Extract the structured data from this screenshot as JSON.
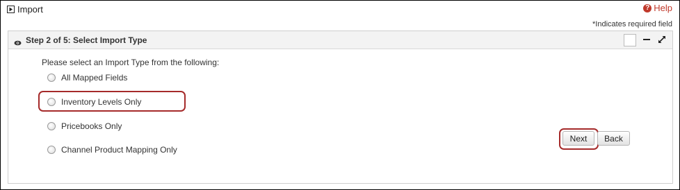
{
  "window": {
    "title": "Import",
    "help_label": "Help",
    "required_note": "*Indicates required field"
  },
  "panel": {
    "title": "Step 2 of 5: Select Import Type",
    "prompt": "Please select an Import Type from the following:",
    "options": [
      {
        "label": "All Mapped Fields",
        "selected": false
      },
      {
        "label": "Inventory Levels Only",
        "selected": false,
        "highlighted": true
      },
      {
        "label": "Pricebooks Only",
        "selected": false
      },
      {
        "label": "Channel Product Mapping Only",
        "selected": false
      }
    ]
  },
  "buttons": {
    "next_label": "Next",
    "back_label": "Back"
  },
  "colors": {
    "accent_red": "#a52a2a",
    "help_red": "#c0392b"
  },
  "icons": {
    "title_icon": "play-square-icon",
    "help_icon": "question-circle-icon",
    "panel_icon": "eye-icon",
    "minimize_icon": "minus-icon",
    "expand_icon": "expand-arrows-icon"
  }
}
